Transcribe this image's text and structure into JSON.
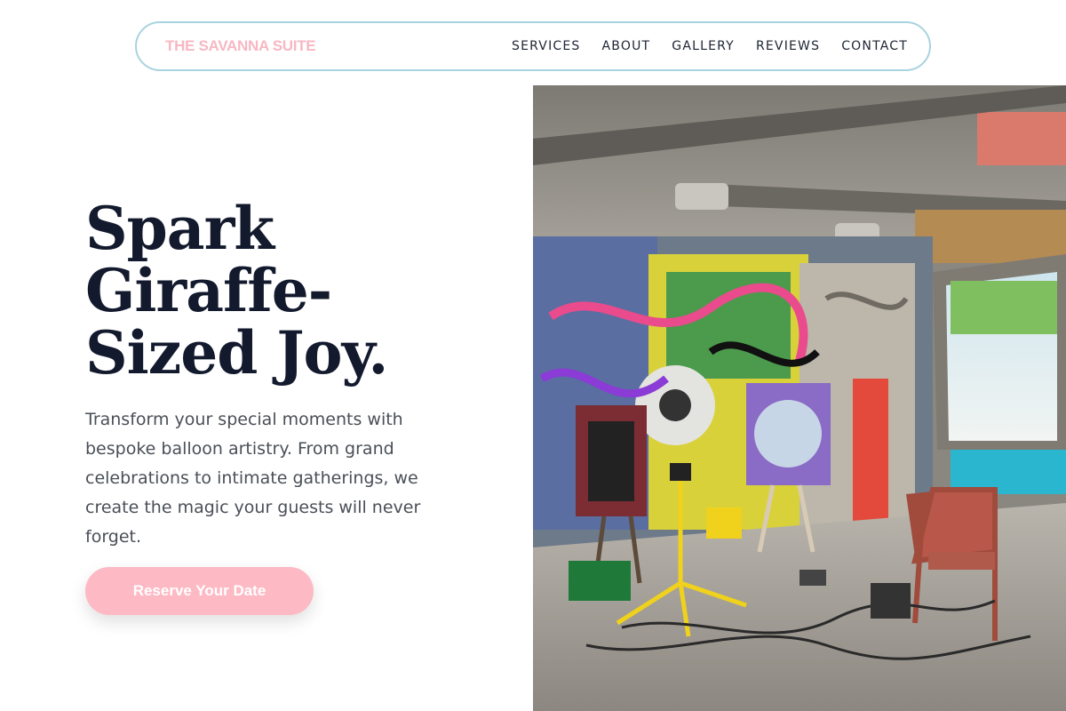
{
  "brand": {
    "name": "THE SAVANNA SUITE",
    "color": "#f7b8c3"
  },
  "nav": {
    "items": [
      {
        "label": "SERVICES"
      },
      {
        "label": "ABOUT"
      },
      {
        "label": "GALLERY"
      },
      {
        "label": "REVIEWS"
      },
      {
        "label": "CONTACT"
      }
    ]
  },
  "hero": {
    "title_lines": [
      "Spark",
      "Giraffe-",
      "Sized Joy."
    ],
    "description": "Transform your special moments with bespoke balloon artistry. From grand celebrations to intimate gatherings, we create the magic your guests will never forget.",
    "cta_label": "Reserve Your Date",
    "cta_color": "#fdb9c4"
  },
  "image": {
    "subject": "graffiti-covered art studio with easels, paintings, tripod light and chairs"
  }
}
